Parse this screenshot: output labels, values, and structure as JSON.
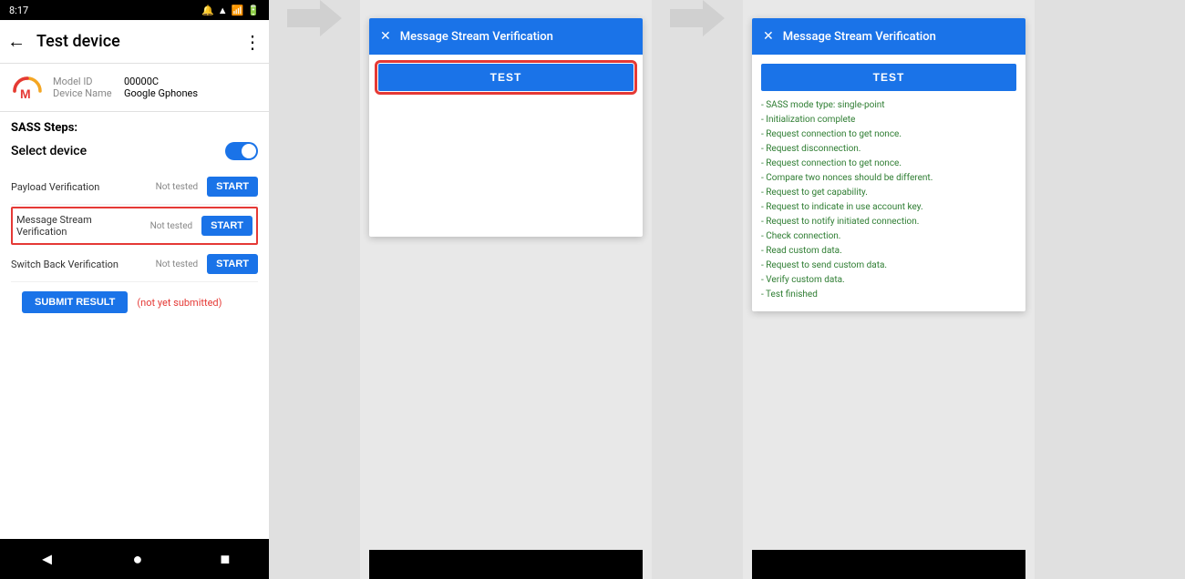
{
  "statusBar": {
    "time": "8:17",
    "icons": "🔔 📶 🔋"
  },
  "appBar": {
    "title": "Test device",
    "backIcon": "←",
    "moreIcon": "⋮"
  },
  "deviceInfo": {
    "modelIdLabel": "Model ID",
    "modelIdValue": "00000C",
    "deviceNameLabel": "Device Name",
    "deviceNameValue": "Google Gphones"
  },
  "sassSteps": {
    "title": "SASS Steps:",
    "selectDeviceLabel": "Select device",
    "steps": [
      {
        "name": "Payload Verification",
        "status": "Not tested",
        "btnLabel": "START",
        "highlighted": false
      },
      {
        "name": "Message Stream\nVerification",
        "status": "Not tested",
        "btnLabel": "START",
        "highlighted": true
      },
      {
        "name": "Switch Back Verification",
        "status": "Not tested",
        "btnLabel": "START",
        "highlighted": false
      }
    ]
  },
  "submitRow": {
    "btnLabel": "SUBMIT RESULT",
    "statusText": "(not yet submitted)"
  },
  "navBar": {
    "backIcon": "◄",
    "homeIcon": "●",
    "recentIcon": "■"
  },
  "dialog1": {
    "title": "Message Stream Verification",
    "closeIcon": "✕",
    "testBtnLabel": "TEST",
    "showHighlight": true,
    "logLines": []
  },
  "dialog2": {
    "title": "Message Stream Verification",
    "closeIcon": "✕",
    "testBtnLabel": "TEST",
    "showHighlight": false,
    "logLines": [
      "- SASS mode type: single-point",
      "- Initialization complete",
      "- Request connection to get nonce.",
      "- Request disconnection.",
      "- Request connection to get nonce.",
      "- Compare two nonces should be different.",
      "- Request to get capability.",
      "- Request to indicate in use account key.",
      "- Request to notify initiated connection.",
      "- Check connection.",
      "- Read custom data.",
      "- Request to send custom data.",
      "- Verify custom data.",
      "- Test finished"
    ]
  }
}
